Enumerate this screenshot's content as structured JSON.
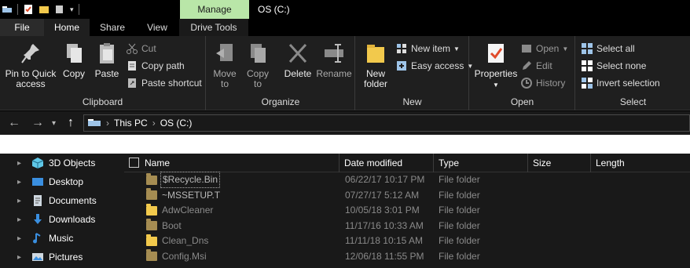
{
  "titlebar": {
    "manage_tab": "Manage",
    "window_title": "OS (C:)"
  },
  "tabs": [
    "File",
    "Home",
    "Share",
    "View",
    "Drive Tools"
  ],
  "ribbon": {
    "clipboard": {
      "label": "Clipboard",
      "pin": [
        "Pin to Quick",
        "access"
      ],
      "copy": "Copy",
      "paste": "Paste",
      "cut": "Cut",
      "copy_path": "Copy path",
      "paste_shortcut": "Paste shortcut"
    },
    "organize": {
      "label": "Organize",
      "move_to": [
        "Move",
        "to"
      ],
      "copy_to": [
        "Copy",
        "to"
      ],
      "delete": "Delete",
      "rename": "Rename"
    },
    "new": {
      "label": "New",
      "new_folder": [
        "New",
        "folder"
      ],
      "new_item": "New item",
      "easy_access": "Easy access"
    },
    "open": {
      "label": "Open",
      "properties": "Properties",
      "open": "Open",
      "edit": "Edit",
      "history": "History"
    },
    "select": {
      "label": "Select",
      "select_all": "Select all",
      "select_none": "Select none",
      "invert_selection": "Invert selection"
    }
  },
  "address": {
    "crumbs": [
      "This PC",
      "OS (C:)"
    ]
  },
  "nav": {
    "items": [
      {
        "label": "3D Objects",
        "icon": "3d-objects-icon"
      },
      {
        "label": "Desktop",
        "icon": "desktop-icon"
      },
      {
        "label": "Documents",
        "icon": "documents-icon"
      },
      {
        "label": "Downloads",
        "icon": "downloads-icon"
      },
      {
        "label": "Music",
        "icon": "music-icon"
      },
      {
        "label": "Pictures",
        "icon": "pictures-icon"
      }
    ]
  },
  "columns": [
    "Name",
    "Date modified",
    "Type",
    "Size",
    "Length"
  ],
  "files": [
    {
      "name": "$Recycle.Bin",
      "date": "06/22/17 10:17 PM",
      "type": "File folder"
    },
    {
      "name": "~MSSETUP.T",
      "date": "07/27/17 5:12 AM",
      "type": "File folder"
    },
    {
      "name": "AdwCleaner",
      "date": "10/05/18 3:01 PM",
      "type": "File folder"
    },
    {
      "name": "Boot",
      "date": "11/17/16 10:33 AM",
      "type": "File folder"
    },
    {
      "name": "Clean_Dns",
      "date": "11/11/18 10:15 AM",
      "type": "File folder"
    },
    {
      "name": "Config.Msi",
      "date": "12/06/18 11:55 PM",
      "type": "File folder"
    }
  ],
  "colors": {
    "manage_tab": "#b9e6a8",
    "folder": "#f2c94c",
    "hidden_folder": "#a58c52",
    "background": "#191919"
  }
}
